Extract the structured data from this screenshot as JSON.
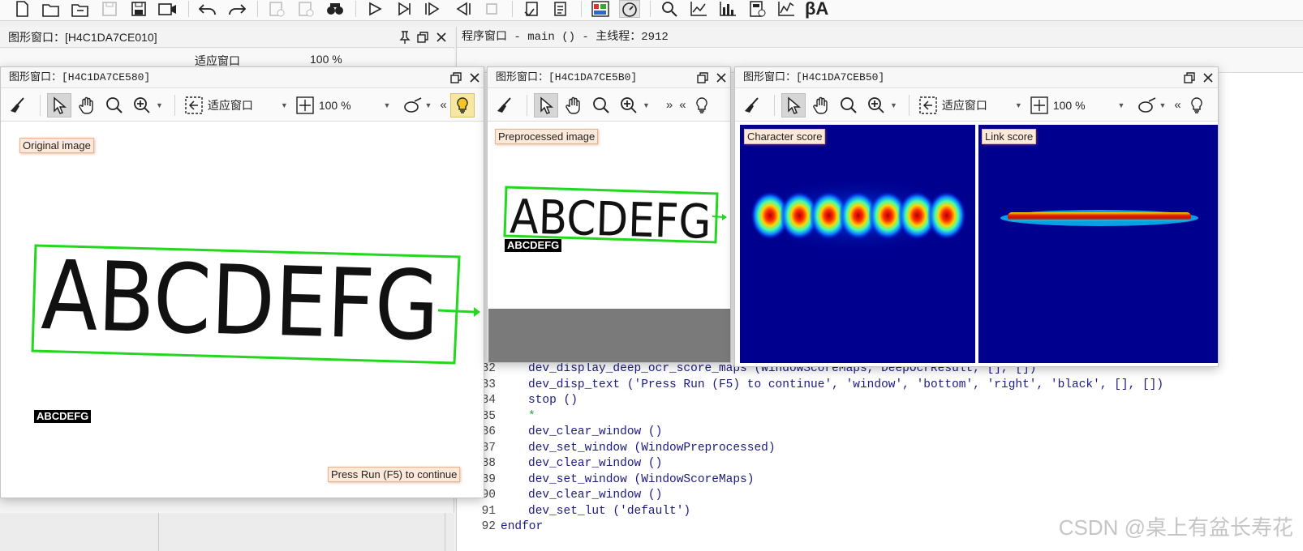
{
  "main_toolbar": {
    "icons": [
      "new-file-icon",
      "open-folder-icon",
      "open-recent-icon",
      "save-disabled-icon",
      "save-all-icon",
      "record-icon",
      "undo-icon",
      "redo-icon",
      "comment-disabled-icon",
      "uncomment-disabled-icon",
      "inspect-icon",
      "run-icon",
      "step-into-icon",
      "step-over-icon",
      "step-out-icon",
      "stop-icon",
      "activate-icon",
      "deactivate-icon",
      "dev-window-icon",
      "timing-icon",
      "find-icon",
      "chart-icon",
      "histogram-icon",
      "calc-icon",
      "profile-icon"
    ],
    "last_label": "βA"
  },
  "back_window": {
    "title": "图形窗口：[H4C1DA7CE010]",
    "fit_label": "适应窗口",
    "zoom": "100 %"
  },
  "program_window": {
    "title": "程序窗口 - main () - 主线程：2912",
    "code_lines": [
      {
        "num": "82",
        "text": "dev_display_deep_ocr_score_maps (WindowScoreMaps, DeepOcrResult, [], [])",
        "kind": "code"
      },
      {
        "num": "83",
        "text": "dev_disp_text ('Press Run (F5) to continue', 'window', 'bottom', 'right', 'black', [], [])",
        "kind": "code"
      },
      {
        "num": "84",
        "text": "stop ()",
        "kind": "code"
      },
      {
        "num": "85",
        "text": "*",
        "kind": "comment"
      },
      {
        "num": "86",
        "text": "dev_clear_window ()",
        "kind": "code"
      },
      {
        "num": "87",
        "text": "dev_set_window (WindowPreprocessed)",
        "kind": "code"
      },
      {
        "num": "88",
        "text": "dev_clear_window ()",
        "kind": "code"
      },
      {
        "num": "89",
        "text": "dev_set_window (WindowScoreMaps)",
        "kind": "code"
      },
      {
        "num": "90",
        "text": "dev_clear_window ()",
        "kind": "code"
      },
      {
        "num": "91",
        "text": "dev_set_lut ('default')",
        "kind": "code"
      },
      {
        "num": "92",
        "text": "endfor",
        "kind": "kw"
      }
    ]
  },
  "window_original": {
    "title": "图形窗口：[H4C1DA7CE580]",
    "fit_label": "适应窗口",
    "zoom": "100 %",
    "tag": "Original image",
    "word": "ABCDEFG",
    "ocr_result": "ABCDEFG",
    "continue_text": "Press Run (F5) to continue"
  },
  "window_preprocessed": {
    "title": "图形窗口：[H4C1DA7CE5B0]",
    "tag": "Preprocessed image",
    "word": "ABCDEFG",
    "ocr_result": "ABCDEFG"
  },
  "window_scores": {
    "title": "图形窗口：[H4C1DA7CEB50]",
    "fit_label": "适应窗口",
    "zoom": "100 %",
    "char_tag": "Character score",
    "link_tag": "Link score"
  },
  "watermark": "CSDN @桌上有盆长寿花",
  "colors": {
    "heatmap_bg": "#00008f",
    "box_green": "#22d81e",
    "tag_bg": "#fde9d9"
  }
}
